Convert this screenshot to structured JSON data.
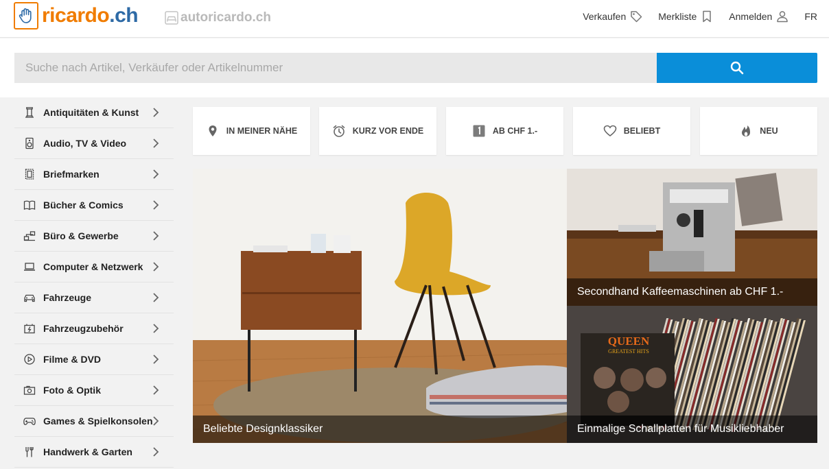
{
  "header": {
    "logo_text_main": "ricardo",
    "logo_text_dot": ".",
    "logo_text_tld": "ch",
    "secondary_logo": "autoricardo.ch",
    "nav": {
      "sell": "Verkaufen",
      "watchlist": "Merkliste",
      "login": "Anmelden",
      "language": "FR"
    }
  },
  "search": {
    "placeholder": "Suche nach Artikel, Verkäufer oder Artikelnummer",
    "value": ""
  },
  "categories": [
    {
      "label": "Antiquitäten & Kunst",
      "icon": "column-icon"
    },
    {
      "label": "Audio, TV & Video",
      "icon": "speaker-icon"
    },
    {
      "label": "Briefmarken",
      "icon": "stamp-icon"
    },
    {
      "label": "Bücher & Comics",
      "icon": "book-icon"
    },
    {
      "label": "Büro & Gewerbe",
      "icon": "office-icon"
    },
    {
      "label": "Computer & Netzwerk",
      "icon": "laptop-icon"
    },
    {
      "label": "Fahrzeuge",
      "icon": "car-icon"
    },
    {
      "label": "Fahrzeugzubehör",
      "icon": "battery-icon"
    },
    {
      "label": "Filme & DVD",
      "icon": "play-icon"
    },
    {
      "label": "Foto & Optik",
      "icon": "camera-icon"
    },
    {
      "label": "Games & Spielkonsolen",
      "icon": "gamepad-icon"
    },
    {
      "label": "Handwerk & Garten",
      "icon": "tools-icon"
    }
  ],
  "quick_tiles": [
    {
      "label": "IN MEINER NÄHE",
      "icon": "location-pin-icon"
    },
    {
      "label": "KURZ VOR ENDE",
      "icon": "alarm-clock-icon"
    },
    {
      "label": "AB CHF 1.-",
      "icon": "one-franc-icon",
      "badge": "1"
    },
    {
      "label": "BELIEBT",
      "icon": "heart-icon"
    },
    {
      "label": "NEU",
      "icon": "flame-icon"
    }
  ],
  "promos": [
    {
      "caption": "Beliebte Designklassiker"
    },
    {
      "caption": "Secondhand Kaffeemaschinen ab CHF 1.-"
    },
    {
      "caption": "Einmalige Schallplatten für Musikliebhaber",
      "album_title": "QUEEN",
      "album_subtitle": "GREATEST HITS"
    }
  ],
  "colors": {
    "brand_orange": "#f07c00",
    "brand_blue": "#2d6aa6",
    "search_button": "#0a8ed9"
  }
}
